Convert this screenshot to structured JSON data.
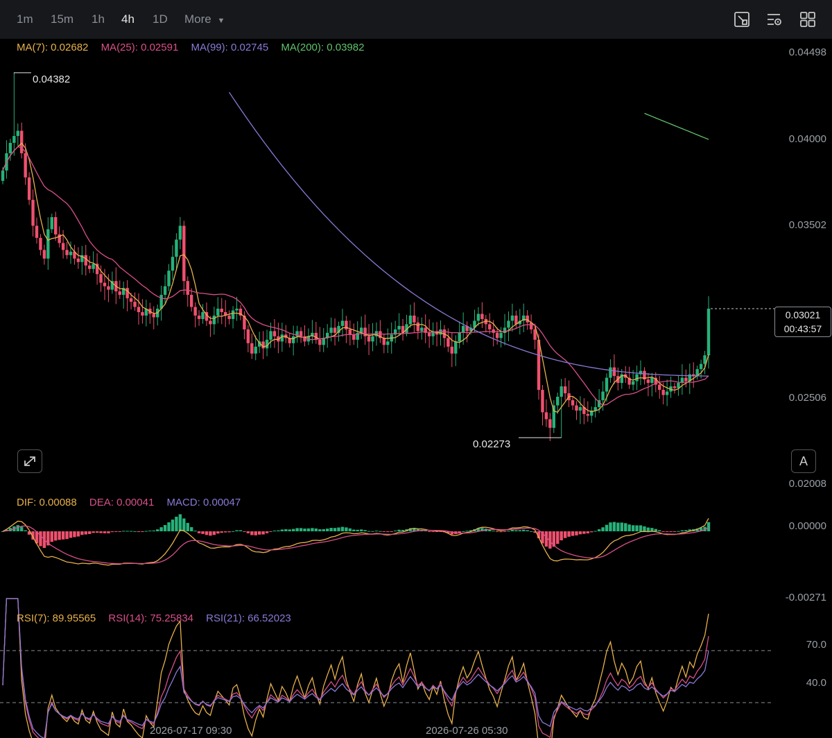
{
  "toolbar": {
    "timeframes": [
      "1m",
      "15m",
      "1h",
      "4h",
      "1D"
    ],
    "active_timeframe": "4h",
    "more_label": "More",
    "icons": [
      "drawing-tools-icon",
      "indicator-settings-icon",
      "layout-grid-icon"
    ]
  },
  "legends": {
    "ma": [
      {
        "label": "MA(7): 0.02682",
        "color": "#e8b14b"
      },
      {
        "label": "MA(25): 0.02591",
        "color": "#d9508a"
      },
      {
        "label": "MA(99): 0.02745",
        "color": "#8a7ad6"
      },
      {
        "label": "MA(200): 0.03982",
        "color": "#5fc46a"
      }
    ],
    "macd": [
      {
        "label": "DIF: 0.00088",
        "color": "#e8b14b"
      },
      {
        "label": "DEA: 0.00041",
        "color": "#d9508a"
      },
      {
        "label": "MACD: 0.00047",
        "color": "#8a7ad6"
      }
    ],
    "rsi": [
      {
        "label": "RSI(7): 89.95565",
        "color": "#e8b14b"
      },
      {
        "label": "RSI(14): 75.25834",
        "color": "#d9508a"
      },
      {
        "label": "RSI(21): 66.52023",
        "color": "#8a7ad6"
      }
    ]
  },
  "price_tag": {
    "price": "0.03021",
    "countdown": "00:43:57"
  },
  "extremes": {
    "high": "0.04382",
    "low": "0.02273"
  },
  "auto_button_label": "A",
  "time_labels": [
    "2026-07-17 09:30",
    "2026-07-26 05:30"
  ],
  "colors": {
    "up": "#26b27a",
    "down": "#f0506e",
    "background": "#000000"
  },
  "chart_data": [
    {
      "type": "candlestick",
      "title": "",
      "y_axis_ticks": [
        "0.04498",
        "0.04000",
        "0.03502",
        "0.03021",
        "0.02506",
        "0.02008"
      ],
      "ylim": [
        0.02008,
        0.04498
      ],
      "closes": [
        0.0382,
        0.0392,
        0.0398,
        0.0402,
        0.0405,
        0.0392,
        0.0378,
        0.0365,
        0.035,
        0.0343,
        0.0336,
        0.0331,
        0.0348,
        0.0355,
        0.0345,
        0.034,
        0.0336,
        0.0333,
        0.0335,
        0.0331,
        0.0329,
        0.0333,
        0.0327,
        0.0325,
        0.0328,
        0.0322,
        0.0317,
        0.0315,
        0.0313,
        0.0318,
        0.0312,
        0.031,
        0.0314,
        0.0308,
        0.0306,
        0.0303,
        0.03,
        0.0298,
        0.0302,
        0.0299,
        0.0297,
        0.0302,
        0.031,
        0.0315,
        0.0324,
        0.0332,
        0.0342,
        0.035,
        0.0318,
        0.031,
        0.0303,
        0.0298,
        0.0296,
        0.03,
        0.0295,
        0.0293,
        0.0298,
        0.0302,
        0.03,
        0.0298,
        0.0296,
        0.0301,
        0.0302,
        0.0298,
        0.029,
        0.0282,
        0.0276,
        0.028,
        0.0283,
        0.0279,
        0.0284,
        0.0289,
        0.0286,
        0.0283,
        0.0287,
        0.0285,
        0.0282,
        0.0286,
        0.0289,
        0.0286,
        0.0283,
        0.0286,
        0.0288,
        0.0284,
        0.0281,
        0.0285,
        0.0288,
        0.0291,
        0.0288,
        0.0292,
        0.0295,
        0.029,
        0.0287,
        0.0284,
        0.0288,
        0.0291,
        0.0286,
        0.0283,
        0.0286,
        0.0289,
        0.0285,
        0.0281,
        0.0283,
        0.0287,
        0.029,
        0.0292,
        0.0288,
        0.0293,
        0.0298,
        0.0294,
        0.0289,
        0.0291,
        0.0288,
        0.0286,
        0.0289,
        0.0287,
        0.029,
        0.0285,
        0.028,
        0.0276,
        0.0283,
        0.0288,
        0.0292,
        0.0289,
        0.0291,
        0.0295,
        0.0299,
        0.0296,
        0.0293,
        0.029,
        0.0288,
        0.0285,
        0.0288,
        0.0291,
        0.0295,
        0.0298,
        0.0293,
        0.0295,
        0.0298,
        0.0294,
        0.029,
        0.0284,
        0.0255,
        0.0242,
        0.0238,
        0.0233,
        0.0246,
        0.0251,
        0.0257,
        0.0253,
        0.0249,
        0.0246,
        0.0243,
        0.0245,
        0.0241,
        0.024,
        0.0243,
        0.0245,
        0.0249,
        0.0254,
        0.0262,
        0.0268,
        0.0263,
        0.0259,
        0.0264,
        0.0262,
        0.0258,
        0.026,
        0.0264,
        0.0266,
        0.0261,
        0.0259,
        0.0262,
        0.0258,
        0.0255,
        0.0252,
        0.0254,
        0.0257,
        0.0256,
        0.0259,
        0.0262,
        0.026,
        0.0264,
        0.0263,
        0.0267,
        0.027,
        0.0275,
        0.0302
      ]
    },
    {
      "type": "line",
      "title": "MACD",
      "y_axis_ticks": [
        "0.00000",
        "-0.00271"
      ],
      "ylim": [
        -0.00271,
        0.0
      ]
    },
    {
      "type": "line",
      "title": "RSI",
      "y_axis_ticks": [
        "70.0",
        "40.0"
      ],
      "ylim": [
        40.0,
        70.0
      ]
    }
  ]
}
